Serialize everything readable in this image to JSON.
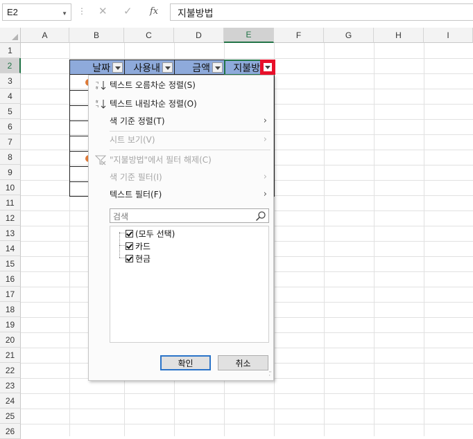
{
  "formula_bar": {
    "name_box": "E2",
    "cancel_icon": "cancel-icon",
    "enter_icon": "check-icon",
    "fx_label": "fx",
    "formula": "지불방법"
  },
  "columns": [
    "A",
    "B",
    "C",
    "D",
    "E",
    "F",
    "G",
    "H",
    "I"
  ],
  "rows": [
    "1",
    "2",
    "3",
    "4",
    "5",
    "6",
    "7",
    "8",
    "9",
    "10",
    "11",
    "12",
    "13",
    "14",
    "15",
    "16",
    "17",
    "18",
    "19",
    "20",
    "21",
    "22",
    "23",
    "24",
    "25",
    "26"
  ],
  "table": {
    "headers": [
      "날짜",
      "사용내",
      "금액",
      "지불방"
    ]
  },
  "menu": {
    "sort_asc": "텍스트 오름차순 정렬(S)",
    "sort_desc": "텍스트 내림차순 정렬(O)",
    "sort_by_color": "색 기준 정렬(T)",
    "sheet_view": "시트 보기(V)",
    "clear_filter": "\"지불방법\"에서 필터 해제(C)",
    "filter_by_color": "색 기준 필터(I)",
    "text_filter": "텍스트 필터(F)",
    "search_placeholder": "검색",
    "items": [
      "(모두 선택)",
      "카드",
      "현금"
    ],
    "ok": "확인",
    "cancel": "취소"
  }
}
